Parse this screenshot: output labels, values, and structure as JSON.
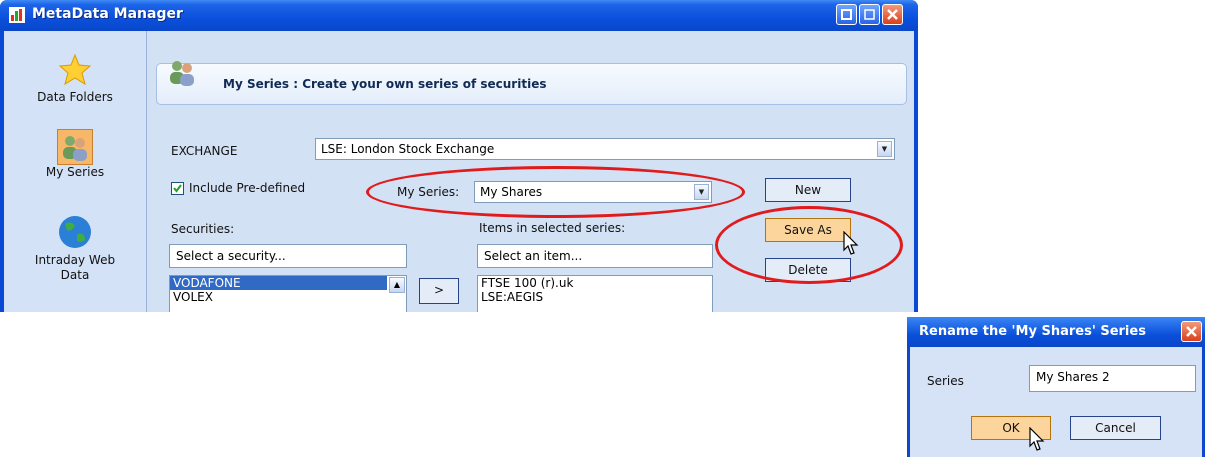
{
  "window": {
    "title": "MetaData Manager"
  },
  "sidebar": {
    "items": [
      {
        "label": "Data Folders",
        "icon": "star-icon"
      },
      {
        "label": "My Series",
        "icon": "people-icon"
      },
      {
        "label": "Intraday Web Data",
        "icon": "globe-icon"
      }
    ]
  },
  "header": {
    "title": "My Series : Create your own series of securities"
  },
  "form": {
    "exchange_label": "EXCHANGE",
    "exchange_value": "LSE: London Stock Exchange",
    "include_predefined_label": "Include Pre-defined",
    "include_predefined_checked": true,
    "my_series_label": "My Series:",
    "my_series_value": "My Shares",
    "securities_label": "Securities:",
    "items_label": "Items in selected series:",
    "security_search_placeholder": "Select a security...",
    "item_search_placeholder": "Select an item...",
    "add_button_label": ">",
    "new_button_label": "New",
    "save_as_button_label": "Save As",
    "delete_button_label": "Delete"
  },
  "securities_list": [
    {
      "label": "VODAFONE",
      "selected": true
    },
    {
      "label": "VOLEX",
      "selected": false
    }
  ],
  "series_items": [
    {
      "label": "FTSE 100 (r).uk"
    },
    {
      "label": "LSE:AEGIS"
    }
  ],
  "dialog": {
    "title": "Rename the 'My Shares' Series",
    "series_label": "Series",
    "series_value": "My Shares 2",
    "ok_label": "OK",
    "cancel_label": "Cancel"
  },
  "colors": {
    "title_bar": "#0a50dc",
    "selection": "#316ac5",
    "highlight_ellipse": "#e11b1b",
    "focused_button": "#fbd59c"
  }
}
